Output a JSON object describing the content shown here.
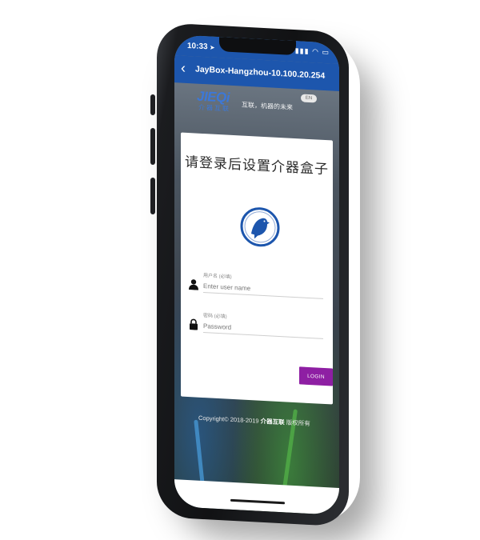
{
  "status_bar": {
    "time": "10:33",
    "location_arrow": "➤"
  },
  "nav": {
    "back_icon": "chevron-left-icon",
    "title": "JayBox-Hangzhou-10.100.20.254"
  },
  "brand": {
    "logo_text": "JIEQi",
    "logo_cn": "介器互联",
    "slogan": "互联，机器的未来",
    "lang_toggle": "EN"
  },
  "login_card": {
    "title": "请登录后设置介器盒子",
    "username_label": "用户名 (必填)",
    "username_placeholder": "Enter user name",
    "password_label": "密码 (必填)",
    "password_placeholder": "Password",
    "login_button": "LOGIN"
  },
  "footer": {
    "copyright_prefix": "Copyright© 2018-2019",
    "company": "介器互联",
    "suffix": "版权所有"
  },
  "colors": {
    "brand_blue": "#1d56ad",
    "login_purple": "#8e1fa3"
  }
}
